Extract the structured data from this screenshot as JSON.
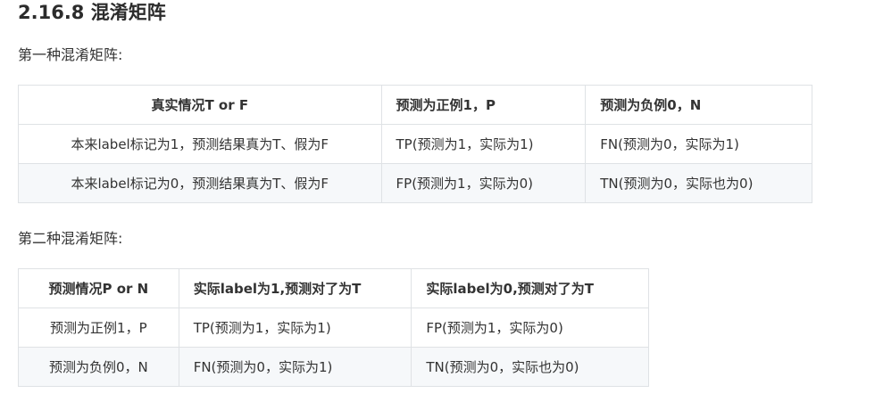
{
  "heading": "2.16.8 混淆矩阵",
  "para1": "第一种混淆矩阵:",
  "table1": {
    "headers": [
      "真实情况T or F",
      "预测为正例1，P",
      "预测为负例0，N"
    ],
    "rows": [
      [
        "本来label标记为1，预测结果真为T、假为F",
        "TP(预测为1，实际为1)",
        "FN(预测为0，实际为1)"
      ],
      [
        "本来label标记为0，预测结果真为T、假为F",
        "FP(预测为1，实际为0)",
        "TN(预测为0，实际也为0)"
      ]
    ]
  },
  "para2": "第二种混淆矩阵:",
  "table2": {
    "headers": [
      "预测情况P or N",
      "实际label为1,预测对了为T",
      "实际label为0,预测对了为T"
    ],
    "rows": [
      [
        "预测为正例1，P",
        "TP(预测为1，实际为1)",
        "FP(预测为1，实际为0)"
      ],
      [
        "预测为负例0，N",
        "FN(预测为0，实际为1)",
        "TN(预测为0，实际也为0)"
      ]
    ]
  }
}
